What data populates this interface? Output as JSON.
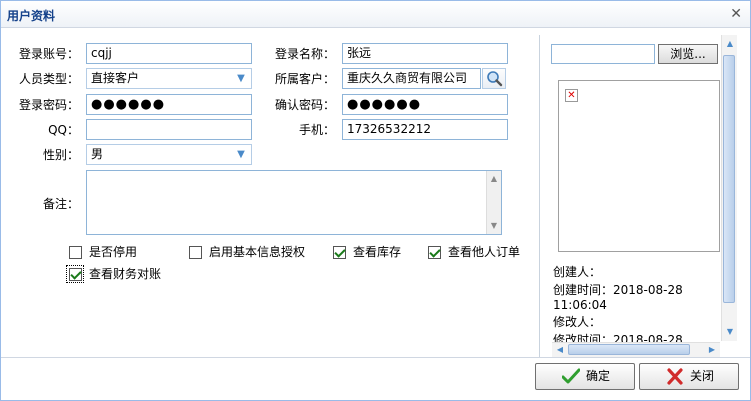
{
  "dialog": {
    "title": "用户资料"
  },
  "form": {
    "login_account": {
      "label": "登录账号：",
      "value": "cqjj"
    },
    "login_name": {
      "label": "登录名称：",
      "value": "张远"
    },
    "person_type": {
      "label": "人员类型：",
      "value": "直接客户"
    },
    "customer": {
      "label": "所属客户：",
      "value": "重庆久久商贸有限公司"
    },
    "password": {
      "label": "登录密码：",
      "value": "●●●●●●"
    },
    "confirm_password": {
      "label": "确认密码：",
      "value": "●●●●●●"
    },
    "qq": {
      "label": "QQ：",
      "value": ""
    },
    "mobile": {
      "label": "手机：",
      "value": "17326532212"
    },
    "gender": {
      "label": "性别：",
      "value": "男"
    },
    "remark": {
      "label": "备注：",
      "value": ""
    }
  },
  "checkboxes": [
    {
      "label": "是否停用",
      "checked": false
    },
    {
      "label": "启用基本信息授权",
      "checked": false
    },
    {
      "label": "查看库存",
      "checked": true
    },
    {
      "label": "查看他人订单",
      "checked": true
    },
    {
      "label": "查看财务对账",
      "checked": true
    }
  ],
  "right_panel": {
    "browse_label": "浏览...",
    "creator": "创建人：",
    "created_time_label": "创建时间：2018-08-28",
    "created_time_clock": "11:06:04",
    "modifier": "修改人：",
    "modified_time_label": "修改时间：2018-08-28"
  },
  "buttons": {
    "ok": "确定",
    "close": "关闭"
  },
  "colors": {
    "title": "#15428b",
    "border": "#99bbe8",
    "check": "#1a7a1a",
    "close_icon": "#d12b2b",
    "ok_icon": "#2f9e2f"
  }
}
